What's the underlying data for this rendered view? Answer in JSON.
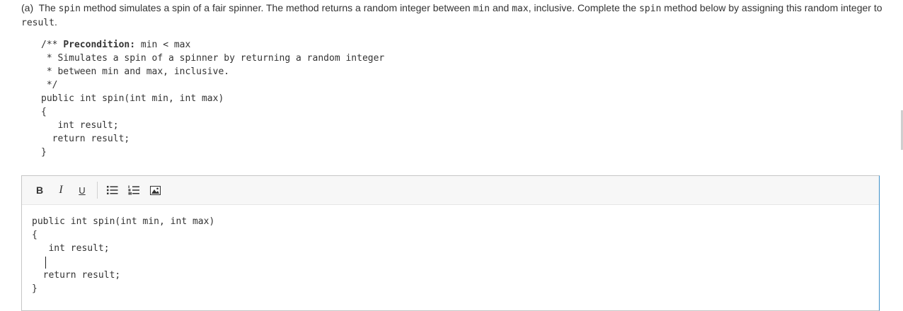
{
  "question": {
    "part": "(a)",
    "t1": "The ",
    "c1": "spin",
    "t2": " method simulates a spin of a fair spinner. The method returns a random integer between ",
    "c2": "min",
    "t3": " and ",
    "c3": "max",
    "t4": ", inclusive. Complete the ",
    "c4": "spin",
    "t5": " method below by assigning this random integer to ",
    "c5": "result",
    "t6": "."
  },
  "given_code": {
    "comment_open": "/** ",
    "precondition_label": "Precondition:",
    "precondition_text": " min < max",
    "line2": " * Simulates a spin of a spinner by returning a random integer",
    "line3": " * between min and max, inclusive.",
    "line4": " */",
    "line5": "public int spin(int min, int max)",
    "line6": "{",
    "line7": "   int result;",
    "line8": "  return result;",
    "line9": "}"
  },
  "toolbar": {
    "bold": "B",
    "italic": "I",
    "underline": "U"
  },
  "answer": {
    "line1": "public int spin(int min, int max)",
    "line2": "{",
    "line3": "   int result;",
    "line4": "",
    "line5": "  return result;",
    "line6": "}"
  }
}
